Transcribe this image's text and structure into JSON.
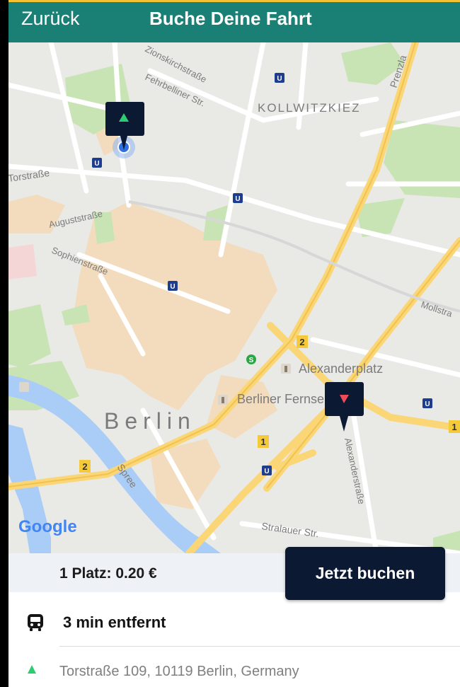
{
  "header": {
    "back_label": "Zurück",
    "title": "Buche Deine Fahrt"
  },
  "map": {
    "labels": {
      "kollwitzkiez": "KOLLWITZKIEZ",
      "prenzlauer": "Prenzla",
      "fehrbelliner": "Fehrbelliner Str.",
      "zionskirch": "Zionskirchstraße",
      "torstrasse": "Torstraße",
      "auguststrasse": "Auguststraße",
      "sophienstrasse": "Sophienstraße",
      "mollstrasse": "Mollstra",
      "alexanderplatz": "Alexanderplatz",
      "fernsehturm": "Berliner Fernsehturm",
      "berlin": "Berlin",
      "spree": "Spree",
      "alexanderstrasse": "Alexanderstraße",
      "stralauer": "Stralauer Str.",
      "google": "Google",
      "road_1": "1",
      "road_2": "2",
      "u_badge": "U",
      "s_badge": "S"
    }
  },
  "booking": {
    "price_label": "1 Platz: 0.20 €",
    "book_button": "Jetzt buchen"
  },
  "trip": {
    "eta": "3 min entfernt",
    "pickup_address": "Torstraße 109, 10119 Berlin, Germany"
  },
  "colors": {
    "header": "#1a7f75",
    "accent_top": "#f6c235",
    "button": "#0c1933",
    "pickup": "#2ecc71",
    "dropoff": "#ef4b5a"
  }
}
